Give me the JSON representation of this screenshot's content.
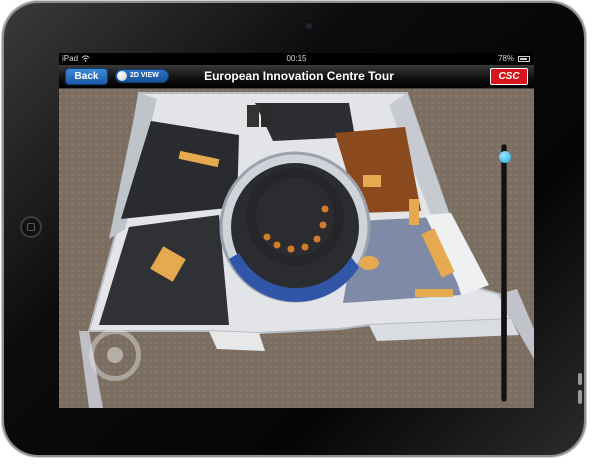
{
  "status_bar": {
    "carrier": "iPad",
    "time": "00:15",
    "battery": "78%"
  },
  "nav": {
    "back_label": "Back",
    "view_toggle_label": "2D VIEW",
    "title": "European Innovation Centre Tour",
    "brand": "CSC"
  },
  "viewer": {
    "mode": "3D",
    "zoom_level": 0.97
  },
  "colors": {
    "accent": "#2a72c8",
    "brand": "#d8141c",
    "slider": "#1aa7e0"
  },
  "icons": [
    "wifi-icon",
    "battery-icon",
    "joystick-icon"
  ]
}
